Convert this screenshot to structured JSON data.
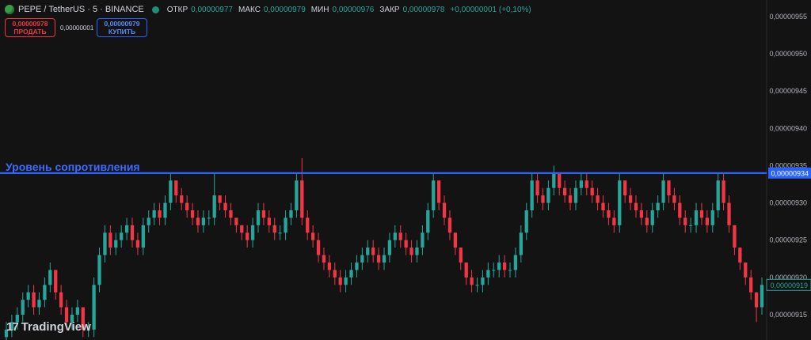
{
  "header": {
    "symbol": "PEPE / TetherUS · 5 · BINANCE",
    "open_label": "ОТКР",
    "open_value": "0,00000977",
    "high_label": "МАКС",
    "high_value": "0,00000979",
    "low_label": "МИН",
    "low_value": "0,00000976",
    "close_label": "ЗАКР",
    "close_value": "0,00000978",
    "change": "+0,00000001 (+0,10%)"
  },
  "trade": {
    "sell_price": "0,00000978",
    "sell_label": "ПРОДАТЬ",
    "spread": "0,00000001",
    "buy_price": "0,00000979",
    "buy_label": "КУПИТЬ"
  },
  "logo": "TradingView",
  "colors": {
    "up": "#26a69a",
    "down": "#f23645",
    "resistance": "#2962ff",
    "background": "#131313"
  },
  "chart_data": {
    "type": "candlestick",
    "interval": "5",
    "y_ticks": [
      "0,00000950",
      "0,00000945",
      "0,00000940",
      "0,00000935",
      "0,00000930",
      "0,00000925",
      "0,00000920",
      "0,00000915"
    ],
    "y_tick_values": [
      9.5,
      9.45,
      9.4,
      9.35,
      9.3,
      9.25,
      9.2,
      9.15
    ],
    "value_unit_note": "values in 1e-6",
    "resistance_label": "Уровень сопротивления",
    "resistance_value": 9.34,
    "resistance_price_label": "0,00000934",
    "last_price_label": "0,00000919",
    "last_price_value": 9.19,
    "candles": [
      [
        9.12,
        9.14,
        9.11,
        9.13
      ],
      [
        9.13,
        9.15,
        9.12,
        9.14
      ],
      [
        9.14,
        9.16,
        9.13,
        9.15
      ],
      [
        9.15,
        9.18,
        9.14,
        9.17
      ],
      [
        9.17,
        9.19,
        9.16,
        9.18
      ],
      [
        9.18,
        9.19,
        9.15,
        9.16
      ],
      [
        9.16,
        9.18,
        9.15,
        9.17
      ],
      [
        9.17,
        9.2,
        9.16,
        9.19
      ],
      [
        9.19,
        9.22,
        9.18,
        9.21
      ],
      [
        9.21,
        9.21,
        9.17,
        9.18
      ],
      [
        9.18,
        9.19,
        9.15,
        9.16
      ],
      [
        9.16,
        9.17,
        9.13,
        9.14
      ],
      [
        9.14,
        9.16,
        9.13,
        9.15
      ],
      [
        9.15,
        9.17,
        9.14,
        9.16
      ],
      [
        9.16,
        9.16,
        9.12,
        9.13
      ],
      [
        9.13,
        9.14,
        9.12,
        9.13
      ],
      [
        9.13,
        9.2,
        9.12,
        9.19
      ],
      [
        9.19,
        9.24,
        9.18,
        9.23
      ],
      [
        9.23,
        9.27,
        9.22,
        9.26
      ],
      [
        9.26,
        9.27,
        9.23,
        9.24
      ],
      [
        9.24,
        9.26,
        9.23,
        9.25
      ],
      [
        9.25,
        9.27,
        9.24,
        9.26
      ],
      [
        9.26,
        9.28,
        9.25,
        9.27
      ],
      [
        9.27,
        9.28,
        9.24,
        9.25
      ],
      [
        9.25,
        9.26,
        9.23,
        9.24
      ],
      [
        9.24,
        9.28,
        9.23,
        9.27
      ],
      [
        9.27,
        9.29,
        9.26,
        9.28
      ],
      [
        9.28,
        9.3,
        9.27,
        9.29
      ],
      [
        9.29,
        9.3,
        9.27,
        9.28
      ],
      [
        9.28,
        9.31,
        9.27,
        9.3
      ],
      [
        9.3,
        9.34,
        9.29,
        9.33
      ],
      [
        9.33,
        9.33,
        9.3,
        9.31
      ],
      [
        9.31,
        9.32,
        9.29,
        9.3
      ],
      [
        9.3,
        9.31,
        9.28,
        9.29
      ],
      [
        9.29,
        9.3,
        9.27,
        9.28
      ],
      [
        9.28,
        9.29,
        9.26,
        9.27
      ],
      [
        9.27,
        9.29,
        9.26,
        9.28
      ],
      [
        9.28,
        9.29,
        9.27,
        9.28
      ],
      [
        9.28,
        9.34,
        9.27,
        9.31
      ],
      [
        9.31,
        9.31,
        9.29,
        9.3
      ],
      [
        9.3,
        9.31,
        9.28,
        9.29
      ],
      [
        9.29,
        9.3,
        9.27,
        9.28
      ],
      [
        9.28,
        9.28,
        9.26,
        9.27
      ],
      [
        9.27,
        9.27,
        9.25,
        9.26
      ],
      [
        9.26,
        9.27,
        9.24,
        9.25
      ],
      [
        9.25,
        9.28,
        9.24,
        9.27
      ],
      [
        9.27,
        9.3,
        9.26,
        9.29
      ],
      [
        9.29,
        9.3,
        9.27,
        9.28
      ],
      [
        9.28,
        9.29,
        9.26,
        9.27
      ],
      [
        9.27,
        9.28,
        9.25,
        9.26
      ],
      [
        9.26,
        9.27,
        9.25,
        9.26
      ],
      [
        9.26,
        9.29,
        9.25,
        9.28
      ],
      [
        9.28,
        9.3,
        9.27,
        9.29
      ],
      [
        9.29,
        9.34,
        9.28,
        9.33
      ],
      [
        9.33,
        9.36,
        9.27,
        9.28
      ],
      [
        9.28,
        9.29,
        9.25,
        9.26
      ],
      [
        9.26,
        9.27,
        9.24,
        9.25
      ],
      [
        9.25,
        9.26,
        9.22,
        9.23
      ],
      [
        9.23,
        9.24,
        9.21,
        9.22
      ],
      [
        9.22,
        9.23,
        9.2,
        9.21
      ],
      [
        9.21,
        9.22,
        9.19,
        9.2
      ],
      [
        9.2,
        9.21,
        9.18,
        9.19
      ],
      [
        9.19,
        9.21,
        9.18,
        9.2
      ],
      [
        9.2,
        9.22,
        9.19,
        9.21
      ],
      [
        9.21,
        9.23,
        9.2,
        9.22
      ],
      [
        9.22,
        9.24,
        9.21,
        9.23
      ],
      [
        9.23,
        9.25,
        9.22,
        9.24
      ],
      [
        9.24,
        9.25,
        9.22,
        9.23
      ],
      [
        9.23,
        9.24,
        9.21,
        9.22
      ],
      [
        9.22,
        9.24,
        9.21,
        9.23
      ],
      [
        9.23,
        9.26,
        9.22,
        9.25
      ],
      [
        9.25,
        9.27,
        9.24,
        9.26
      ],
      [
        9.26,
        9.27,
        9.24,
        9.25
      ],
      [
        9.25,
        9.26,
        9.23,
        9.24
      ],
      [
        9.24,
        9.25,
        9.22,
        9.23
      ],
      [
        9.23,
        9.25,
        9.22,
        9.24
      ],
      [
        9.24,
        9.27,
        9.23,
        9.26
      ],
      [
        9.26,
        9.3,
        9.25,
        9.29
      ],
      [
        9.29,
        9.34,
        9.28,
        9.33
      ],
      [
        9.33,
        9.33,
        9.29,
        9.3
      ],
      [
        9.3,
        9.31,
        9.27,
        9.28
      ],
      [
        9.28,
        9.29,
        9.25,
        9.26
      ],
      [
        9.26,
        9.26,
        9.23,
        9.24
      ],
      [
        9.24,
        9.24,
        9.21,
        9.22
      ],
      [
        9.22,
        9.22,
        9.19,
        9.2
      ],
      [
        9.2,
        9.21,
        9.18,
        9.19
      ],
      [
        9.19,
        9.2,
        9.18,
        9.19
      ],
      [
        9.19,
        9.21,
        9.18,
        9.2
      ],
      [
        9.2,
        9.22,
        9.19,
        9.21
      ],
      [
        9.21,
        9.22,
        9.2,
        9.21
      ],
      [
        9.21,
        9.23,
        9.2,
        9.22
      ],
      [
        9.22,
        9.23,
        9.2,
        9.21
      ],
      [
        9.21,
        9.22,
        9.2,
        9.21
      ],
      [
        9.21,
        9.24,
        9.2,
        9.23
      ],
      [
        9.23,
        9.27,
        9.22,
        9.26
      ],
      [
        9.26,
        9.3,
        9.25,
        9.29
      ],
      [
        9.29,
        9.34,
        9.28,
        9.33
      ],
      [
        9.33,
        9.34,
        9.3,
        9.31
      ],
      [
        9.31,
        9.32,
        9.29,
        9.3
      ],
      [
        9.3,
        9.33,
        9.29,
        9.32
      ],
      [
        9.32,
        9.35,
        9.31,
        9.34
      ],
      [
        9.34,
        9.34,
        9.31,
        9.32
      ],
      [
        9.32,
        9.33,
        9.3,
        9.31
      ],
      [
        9.31,
        9.32,
        9.29,
        9.3
      ],
      [
        9.3,
        9.33,
        9.29,
        9.32
      ],
      [
        9.32,
        9.34,
        9.31,
        9.33
      ],
      [
        9.33,
        9.34,
        9.31,
        9.32
      ],
      [
        9.32,
        9.33,
        9.3,
        9.31
      ],
      [
        9.31,
        9.32,
        9.29,
        9.3
      ],
      [
        9.3,
        9.31,
        9.28,
        9.29
      ],
      [
        9.29,
        9.3,
        9.27,
        9.28
      ],
      [
        9.28,
        9.29,
        9.26,
        9.27
      ],
      [
        9.27,
        9.34,
        9.26,
        9.33
      ],
      [
        9.33,
        9.33,
        9.3,
        9.31
      ],
      [
        9.31,
        9.32,
        9.29,
        9.3
      ],
      [
        9.3,
        9.31,
        9.28,
        9.29
      ],
      [
        9.29,
        9.3,
        9.27,
        9.28
      ],
      [
        9.28,
        9.29,
        9.26,
        9.27
      ],
      [
        9.27,
        9.3,
        9.26,
        9.29
      ],
      [
        9.29,
        9.31,
        9.28,
        9.3
      ],
      [
        9.3,
        9.34,
        9.29,
        9.33
      ],
      [
        9.33,
        9.33,
        9.3,
        9.31
      ],
      [
        9.31,
        9.32,
        9.29,
        9.3
      ],
      [
        9.3,
        9.31,
        9.27,
        9.28
      ],
      [
        9.28,
        9.29,
        9.26,
        9.27
      ],
      [
        9.27,
        9.28,
        9.26,
        9.27
      ],
      [
        9.27,
        9.3,
        9.26,
        9.29
      ],
      [
        9.29,
        9.3,
        9.27,
        9.28
      ],
      [
        9.28,
        9.29,
        9.26,
        9.27
      ],
      [
        9.27,
        9.3,
        9.26,
        9.29
      ],
      [
        9.29,
        9.34,
        9.28,
        9.33
      ],
      [
        9.33,
        9.34,
        9.29,
        9.3
      ],
      [
        9.3,
        9.31,
        9.26,
        9.27
      ],
      [
        9.27,
        9.27,
        9.23,
        9.24
      ],
      [
        9.24,
        9.24,
        9.21,
        9.22
      ],
      [
        9.22,
        9.22,
        9.19,
        9.2
      ],
      [
        9.2,
        9.21,
        9.17,
        9.18
      ],
      [
        9.18,
        9.18,
        9.14,
        9.16
      ],
      [
        9.16,
        9.2,
        9.15,
        9.19
      ]
    ]
  }
}
